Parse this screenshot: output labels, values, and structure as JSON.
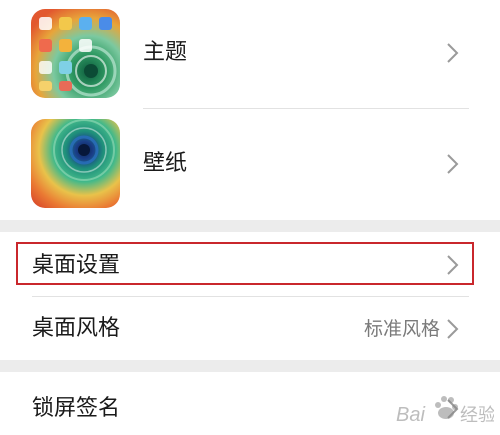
{
  "settings": {
    "theme": {
      "label": "主题",
      "icon": "theme-thumbnail"
    },
    "wallpaper": {
      "label": "壁纸",
      "icon": "wallpaper-thumbnail"
    },
    "desktop_settings": {
      "label": "桌面设置"
    },
    "desktop_style": {
      "label": "桌面风格",
      "value": "标准风格"
    },
    "lock_screen_signature": {
      "label": "锁屏签名"
    }
  },
  "watermark": {
    "text": "Bai 经验"
  },
  "colors": {
    "highlight_border": "#c9272c",
    "background": "#ececec",
    "card": "#ffffff",
    "chevron": "#9a9a9a"
  }
}
